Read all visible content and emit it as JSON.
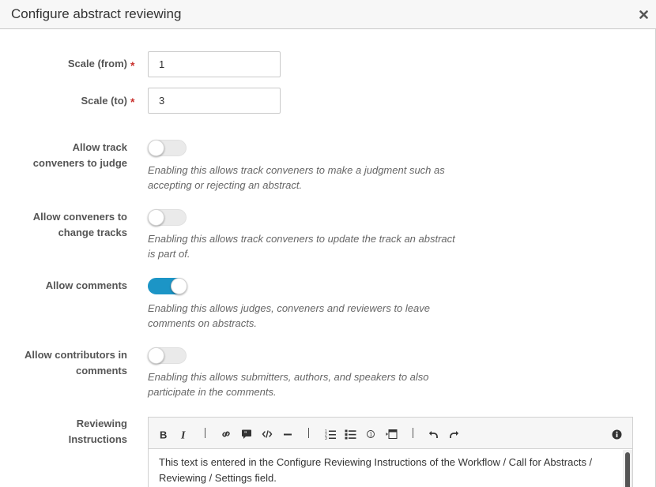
{
  "dialog": {
    "title": "Configure abstract reviewing",
    "close_icon": "close-icon"
  },
  "scale_from": {
    "label": "Scale (from)",
    "required_mark": "*",
    "value": "1"
  },
  "scale_to": {
    "label": "Scale (to)",
    "required_mark": "*",
    "value": "3"
  },
  "toggles": [
    {
      "label_line1": "Allow track",
      "label_line2": "conveners to judge",
      "enabled": false,
      "help_line1": "Enabling this allows track conveners to make a judgment such as",
      "help_line2": "accepting or rejecting an abstract."
    },
    {
      "label_line1": "Allow conveners to",
      "label_line2": "change tracks",
      "enabled": false,
      "help_line1": "Enabling this allows track conveners to update the track an abstract",
      "help_line2": "is part of."
    },
    {
      "label_line1": "Allow comments",
      "label_line2": "",
      "enabled": true,
      "help_line1": "Enabling this allows judges, conveners and reviewers to leave",
      "help_line2": "comments on abstracts."
    },
    {
      "label_line1": "Allow contributors in",
      "label_line2": "comments",
      "enabled": false,
      "help_line1": "Enabling this allows submitters, authors, and speakers to also",
      "help_line2": "participate in the comments."
    }
  ],
  "instructions": {
    "label_line1": "Reviewing",
    "label_line2": "Instructions",
    "toolbar_icons": [
      "bold-icon",
      "italic-icon",
      "link-icon",
      "blockquote-icon",
      "code-icon",
      "horizontal-rule-icon",
      "ordered-list-icon",
      "unordered-list-icon",
      "footnote-icon",
      "preview-icon",
      "undo-icon",
      "redo-icon",
      "help-icon"
    ],
    "content_line1": "This text is entered in the Configure Reviewing Instructions of the Workflow / Call for Abstracts /",
    "content_line2": "Reviewing / Settings field."
  },
  "colors": {
    "toggle_on": "#1c95c6",
    "required": "#c9302c",
    "header_bg": "#f7f7f7"
  }
}
